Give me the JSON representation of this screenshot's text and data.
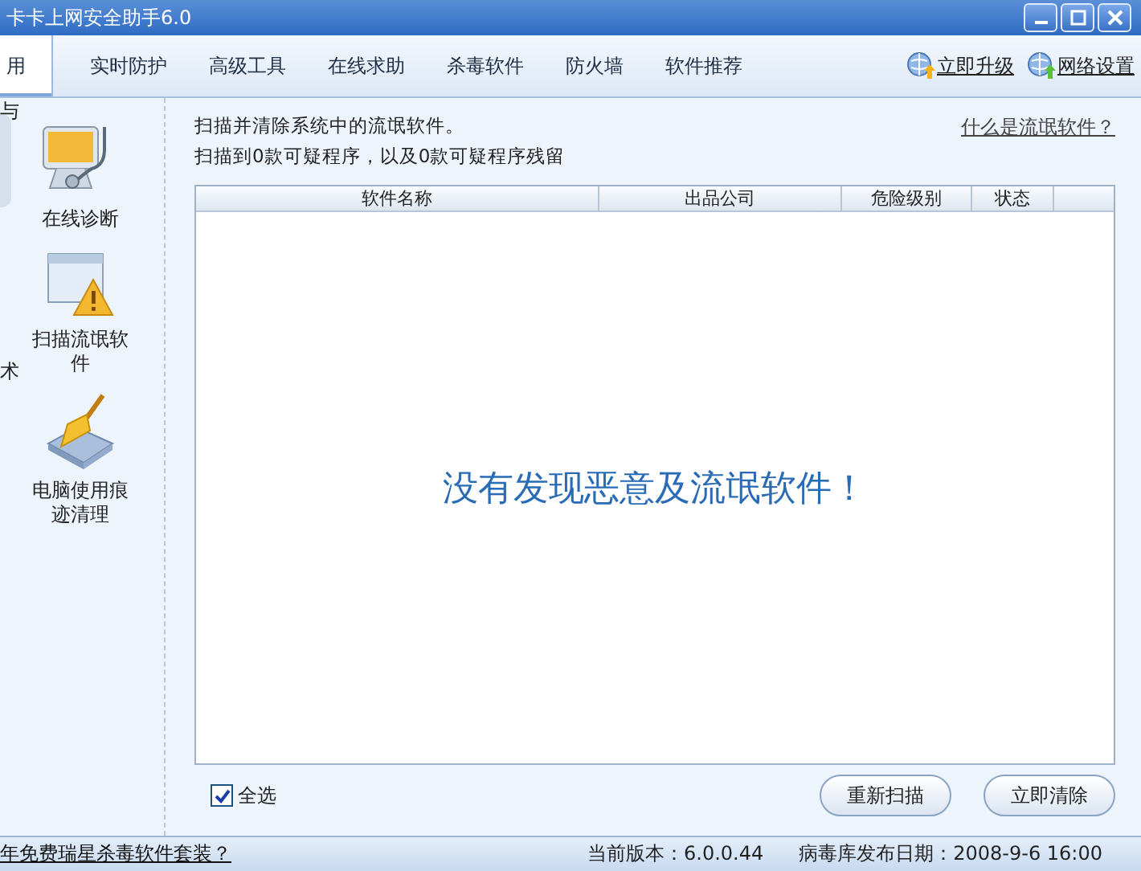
{
  "window": {
    "title": "卡卡上网安全助手6.0"
  },
  "nav": {
    "tabs": [
      {
        "label": "用",
        "selected": true
      },
      {
        "label": "实时防护",
        "selected": false
      },
      {
        "label": "高级工具",
        "selected": false
      },
      {
        "label": "在线求助",
        "selected": false
      },
      {
        "label": "杀毒软件",
        "selected": false
      },
      {
        "label": "防火墙",
        "selected": false
      },
      {
        "label": "软件推荐",
        "selected": false
      }
    ],
    "links": [
      {
        "label": "立即升级",
        "kind": "upgrade"
      },
      {
        "label": "网络设置",
        "kind": "settings"
      }
    ]
  },
  "sidebar": {
    "partial_labels": [
      "与",
      "术"
    ],
    "items": [
      {
        "label": "在线诊断",
        "kind": "monitor"
      },
      {
        "label": "扫描流氓软件",
        "kind": "warning"
      },
      {
        "label": "电脑使用痕迹清理",
        "kind": "broom"
      }
    ]
  },
  "content": {
    "intro": "扫描并清除系统中的流氓软件。",
    "summary": "扫描到0款可疑程序，以及0款可疑程序残留",
    "help_link": "什么是流氓软件？",
    "table": {
      "columns": [
        "软件名称",
        "出品公司",
        "危险级别",
        "状态"
      ],
      "empty_message": "没有发现恶意及流氓软件！"
    },
    "select_all": {
      "label": "全选",
      "checked": true
    },
    "buttons": [
      "重新扫描",
      "立即清除"
    ]
  },
  "status_bar": {
    "promo": "年免费瑞星杀毒软件套装？",
    "version": "当前版本：6.0.0.44",
    "virus_db_date": "病毒库发布日期：2008-9-6 16:00"
  }
}
